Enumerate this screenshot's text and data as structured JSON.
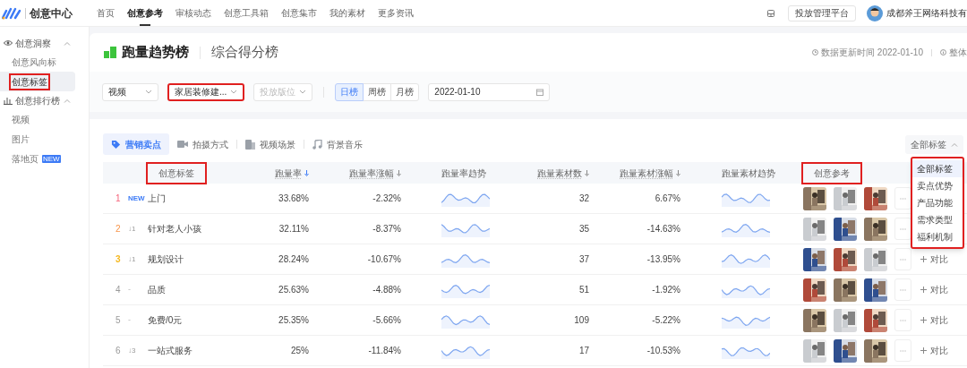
{
  "top_nav": {
    "brand": "创意中心",
    "items": [
      {
        "label": "首页",
        "selected": false
      },
      {
        "label": "创意参考",
        "selected": true
      },
      {
        "label": "审核动态",
        "selected": false
      },
      {
        "label": "创意工具箱",
        "selected": false
      },
      {
        "label": "创意集市",
        "selected": false
      },
      {
        "label": "我的素材",
        "selected": false
      },
      {
        "label": "更多资讯",
        "selected": false
      }
    ],
    "platform_button": "投放管理平台",
    "account": "成都斧王网络科技有"
  },
  "sidebar": {
    "sections": [
      {
        "title": "创意洞察",
        "expanded": true,
        "items": [
          {
            "label": "创意风向标",
            "selected": false,
            "highlighted": false
          },
          {
            "label": "创意标签",
            "selected": true,
            "highlighted": true
          }
        ]
      },
      {
        "title": "创意排行榜",
        "expanded": true,
        "items": [
          {
            "label": "视频",
            "selected": false,
            "highlighted": false
          },
          {
            "label": "图片",
            "selected": false,
            "highlighted": false
          },
          {
            "label": "落地页",
            "selected": false,
            "highlighted": false,
            "badge": "NEW"
          }
        ]
      }
    ]
  },
  "header": {
    "tabs": [
      {
        "label": "跑量趋势榜",
        "selected": true
      },
      {
        "label": "综合得分榜",
        "selected": false
      }
    ],
    "update_time": "数据更新时间 2022-01-10",
    "info": "整体"
  },
  "filters": {
    "selects": [
      {
        "value": "视频",
        "highlighted": false
      },
      {
        "value": "家居装修建...",
        "highlighted": true
      },
      {
        "placeholder": "投放版位",
        "highlighted": false
      }
    ],
    "periods": [
      {
        "label": "日榜",
        "selected": true
      },
      {
        "label": "周榜",
        "selected": false
      },
      {
        "label": "月榜",
        "selected": false
      }
    ],
    "date": "2022-01-10"
  },
  "category_tabs": [
    {
      "label": "营销卖点",
      "selected": true
    },
    {
      "label": "拍摄方式",
      "selected": false
    },
    {
      "label": "视频场景",
      "selected": false
    },
    {
      "label": "背景音乐",
      "selected": false
    }
  ],
  "tag_filter": {
    "value": "全部标签",
    "expanded": true,
    "options": [
      {
        "label": "全部标签",
        "selected": true
      },
      {
        "label": "卖点优势",
        "selected": false
      },
      {
        "label": "产品功能",
        "selected": false
      },
      {
        "label": "需求类型",
        "selected": false
      },
      {
        "label": "福利机制",
        "selected": false
      }
    ],
    "highlighted": true
  },
  "table": {
    "columns": [
      {
        "label": "创意标签",
        "sortable": false,
        "highlighted": true
      },
      {
        "label": "跑量率",
        "sortable": true,
        "sorted": true,
        "highlighted": false
      },
      {
        "label": "跑量率涨幅",
        "sortable": true,
        "sorted": false,
        "highlighted": false
      },
      {
        "label": "跑量率趋势",
        "sortable": false,
        "highlighted": false
      },
      {
        "label": "跑量素材数",
        "sortable": true,
        "sorted": false,
        "highlighted": false
      },
      {
        "label": "跑量素材涨幅",
        "sortable": true,
        "sorted": false,
        "highlighted": false
      },
      {
        "label": "跑量素材趋势",
        "sortable": false,
        "highlighted": false
      },
      {
        "label": "创意参考",
        "sortable": false,
        "highlighted": true
      }
    ],
    "rows": [
      {
        "rank": "1",
        "change": "NEW",
        "kind": "new",
        "tag": "上门",
        "rate": "33.68%",
        "rate_change": "-2.32%",
        "count": "32",
        "count_change": "6.67%"
      },
      {
        "rank": "2",
        "change": "↓1",
        "kind": "down",
        "tag": "针对老人小孩",
        "rate": "32.11%",
        "rate_change": "-8.37%",
        "count": "35",
        "count_change": "-14.63%"
      },
      {
        "rank": "3",
        "change": "↓1",
        "kind": "down",
        "tag": "规划设计",
        "rate": "28.24%",
        "rate_change": "-10.67%",
        "count": "37",
        "count_change": "-13.95%",
        "compare": "对比"
      },
      {
        "rank": "4",
        "change": "-",
        "kind": "flat",
        "tag": "品质",
        "rate": "25.63%",
        "rate_change": "-4.88%",
        "count": "51",
        "count_change": "-1.92%",
        "compare": "对比"
      },
      {
        "rank": "5",
        "change": "-",
        "kind": "flat",
        "tag": "免费/0元",
        "rate": "25.35%",
        "rate_change": "-5.66%",
        "count": "109",
        "count_change": "-5.22%",
        "compare": "对比"
      },
      {
        "rank": "6",
        "change": "↓3",
        "kind": "down",
        "tag": "一站式服务",
        "rate": "25%",
        "rate_change": "-11.84%",
        "count": "17",
        "count_change": "-10.53%",
        "compare": "对比"
      }
    ]
  }
}
